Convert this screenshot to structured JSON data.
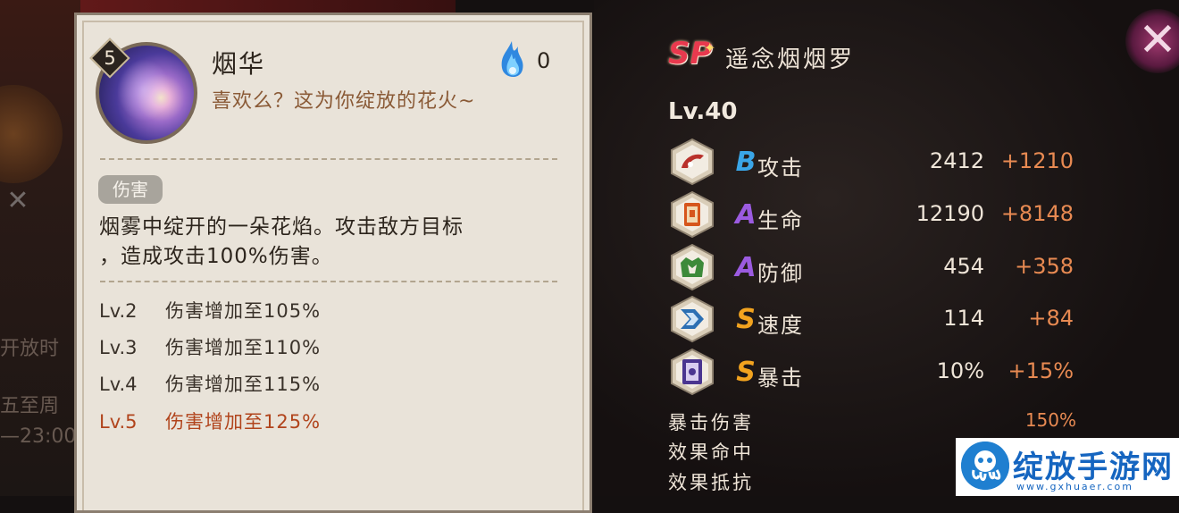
{
  "skill": {
    "level": "5",
    "name": "烟华",
    "quote": "喜欢么？这为你绽放的花火~",
    "fire_cost": "0",
    "tag": "伤害",
    "description": [
      "烟雾中绽开的一朵花焰。攻击敌方目标",
      "，造成攻击100%伤害。"
    ],
    "upgrades": [
      {
        "lv": "Lv.2",
        "text": "伤害增加至105%"
      },
      {
        "lv": "Lv.3",
        "text": "伤害增加至110%"
      },
      {
        "lv": "Lv.4",
        "text": "伤害增加至115%"
      },
      {
        "lv": "Lv.5",
        "text": "伤害增加至125%"
      }
    ]
  },
  "shikigami": {
    "rarity": "SP",
    "name": "遥念烟烟罗",
    "level": "Lv.40",
    "stats": [
      {
        "icon": "attack-icon",
        "grade": "B",
        "grade_color": "#3aa6e8",
        "name": "攻击",
        "base": "2412",
        "bonus": "+1210"
      },
      {
        "icon": "hp-icon",
        "grade": "A",
        "grade_color": "#9b5be0",
        "name": "生命",
        "base": "12190",
        "bonus": "+8148"
      },
      {
        "icon": "defense-icon",
        "grade": "A",
        "grade_color": "#9b5be0",
        "name": "防御",
        "base": "454",
        "bonus": "+358"
      },
      {
        "icon": "speed-icon",
        "grade": "S",
        "grade_color": "#f2a31f",
        "name": "速度",
        "base": "114",
        "bonus": "+84"
      },
      {
        "icon": "crit-icon",
        "grade": "S",
        "grade_color": "#f2a31f",
        "name": "暴击",
        "base": "10%",
        "bonus": "+15%"
      }
    ],
    "extra": [
      {
        "name": "暴击伤害",
        "value": "150%"
      },
      {
        "name": "效果命中",
        "value": ""
      },
      {
        "name": "效果抵抗",
        "value": ""
      }
    ]
  },
  "background": {
    "side_texts": [
      "开放时",
      "五至周",
      "—23:00"
    ]
  },
  "watermark": {
    "text": "绽放手游网",
    "url": "www.gxhuaer.com"
  },
  "colors": {
    "card_bg": "#e9e3d9",
    "current_level": "#b1441c",
    "bonus": "#e88a52"
  }
}
